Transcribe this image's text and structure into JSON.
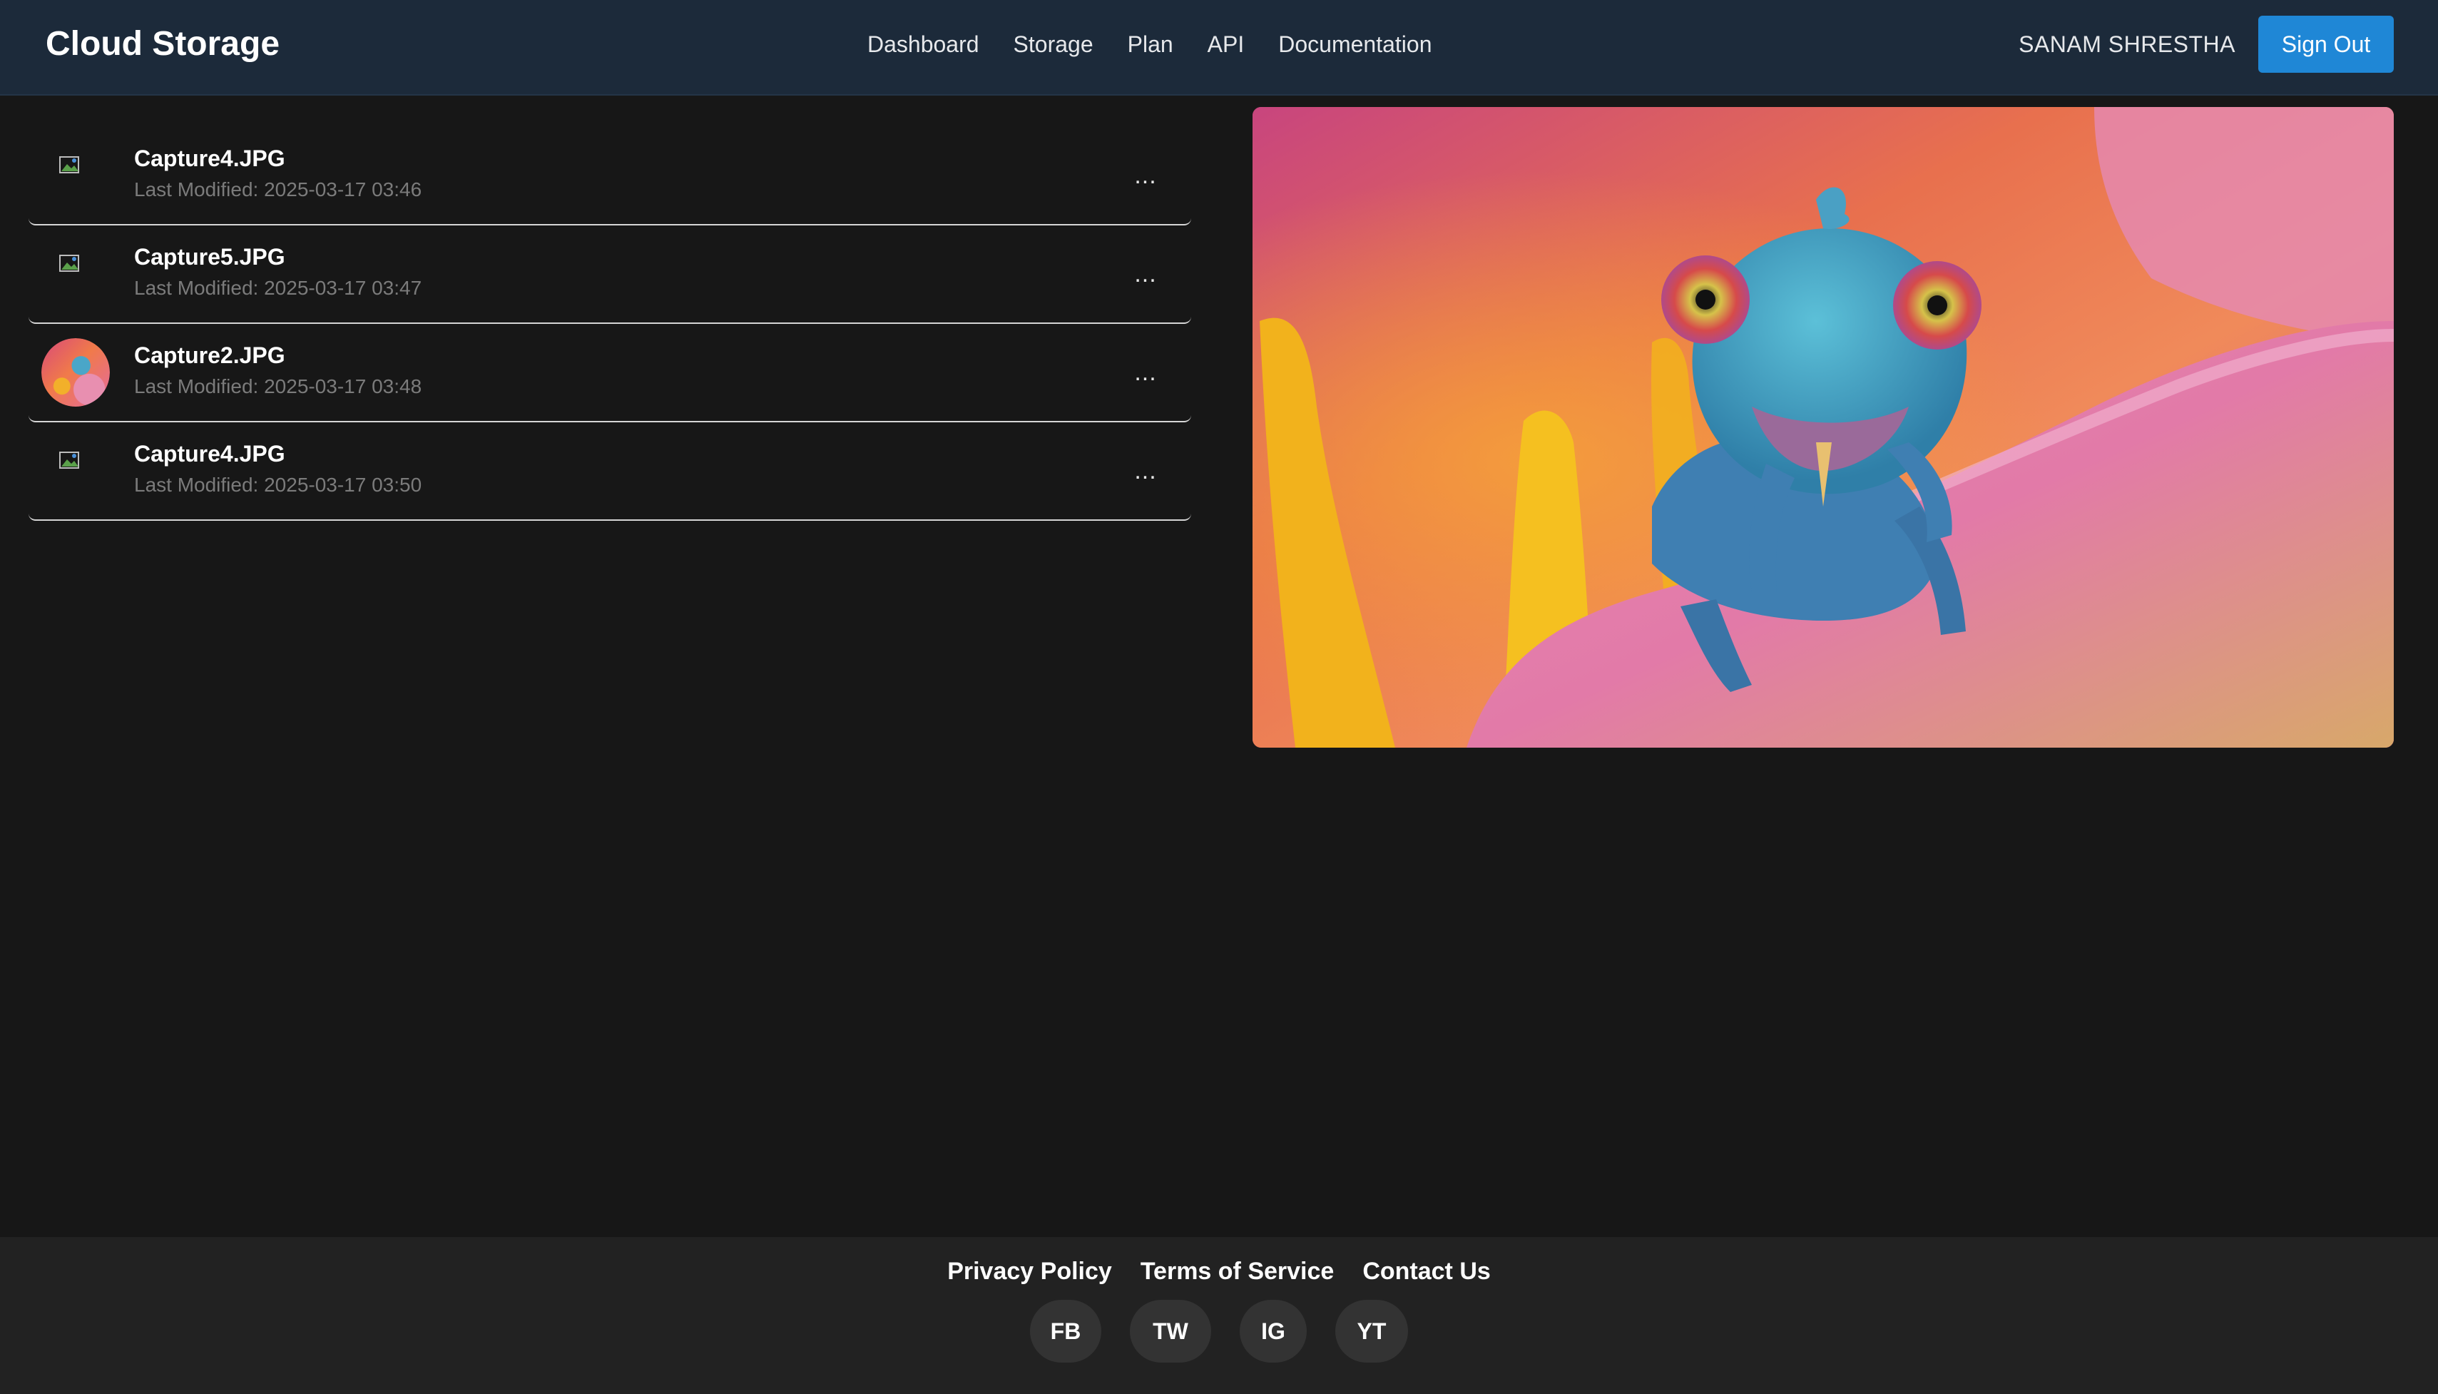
{
  "header": {
    "brand": "Cloud Storage",
    "nav": [
      "Dashboard",
      "Storage",
      "Plan",
      "API",
      "Documentation"
    ],
    "user_name": "SANAM SHRESTHA",
    "sign_out_label": "Sign Out"
  },
  "files": [
    {
      "name": "Capture4.JPG",
      "modified": "Last Modified: 2025-03-17 03:46",
      "thumbnail": "broken-image",
      "more": "..."
    },
    {
      "name": "Capture5.JPG",
      "modified": "Last Modified: 2025-03-17 03:47",
      "thumbnail": "broken-image",
      "more": "..."
    },
    {
      "name": "Capture2.JPG",
      "modified": "Last Modified: 2025-03-17 03:48",
      "thumbnail": "chameleon-photo",
      "more": "..."
    },
    {
      "name": "Capture4.JPG",
      "modified": "Last Modified: 2025-03-17 03:50",
      "thumbnail": "broken-image",
      "more": "..."
    }
  ],
  "footer": {
    "links": [
      "Privacy Policy",
      "Terms of Service",
      "Contact Us"
    ],
    "socials": [
      "FB",
      "TW",
      "IG",
      "YT"
    ]
  },
  "colors": {
    "header_bg": "#1c2a3a",
    "page_bg": "#171717",
    "footer_bg": "#222222",
    "accent": "#1f87d6",
    "muted_text": "#7b7b7b"
  }
}
